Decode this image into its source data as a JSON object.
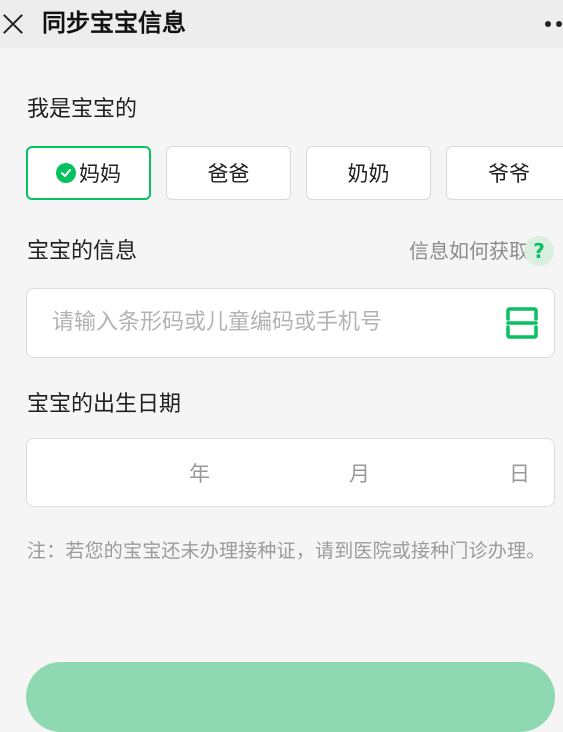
{
  "header": {
    "title": "同步宝宝信息"
  },
  "relation": {
    "label": "我是宝宝的",
    "options": [
      "妈妈",
      "爸爸",
      "奶奶",
      "爷爷"
    ],
    "selected": "妈妈"
  },
  "info": {
    "label": "宝宝的信息",
    "help_text": "信息如何获取",
    "help_icon": "?",
    "input_placeholder": "请输入条形码或儿童编码或手机号",
    "input_value": ""
  },
  "birth": {
    "label": "宝宝的出生日期",
    "year": "年",
    "month": "月",
    "day": "日"
  },
  "note": "注：若您的宝宝还未办理接种证，请到医院或接种门诊办理。",
  "colors": {
    "accent": "#07c160",
    "submit_button": "#8fd9b2",
    "help_icon_bg": "#d9efdf",
    "page_bg": "#f5f5f5",
    "header_bg": "#ededed"
  },
  "icons": {
    "close": "close-icon",
    "more": "more-icon",
    "check": "check-icon",
    "help": "help-icon",
    "scan": "scan-icon"
  }
}
